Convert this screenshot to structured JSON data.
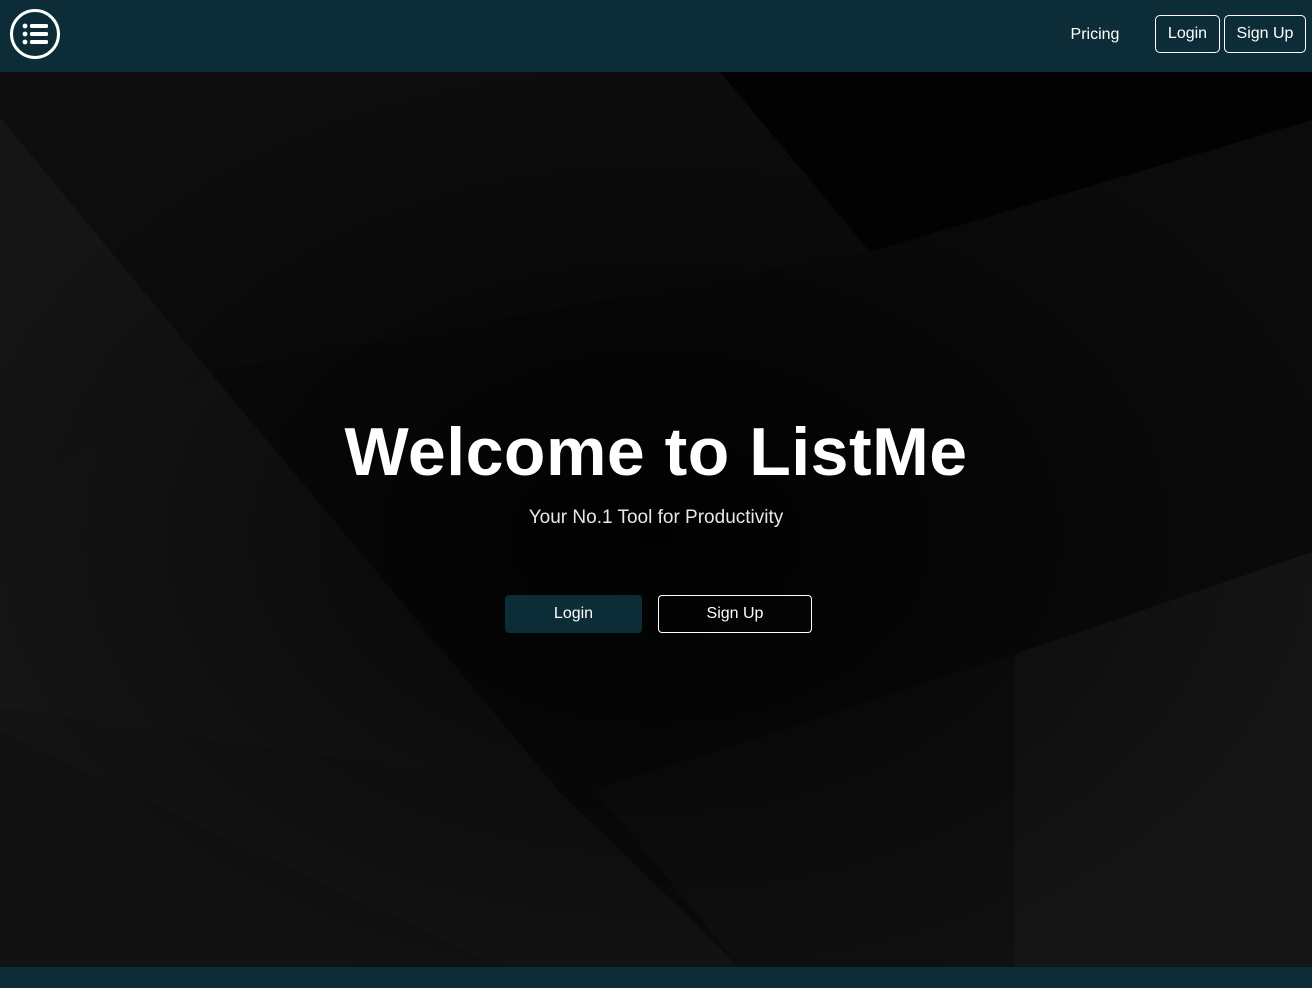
{
  "app": {
    "logo_icon": "list-icon"
  },
  "navbar": {
    "links": {
      "pricing": "Pricing"
    },
    "buttons": {
      "login": "Login",
      "signup": "Sign Up"
    }
  },
  "hero": {
    "title": "Welcome to ListMe",
    "subtitle": "Your No.1 Tool for Productivity",
    "buttons": {
      "login": "Login",
      "signup": "Sign Up"
    }
  },
  "colors": {
    "primary": "#0c2d38",
    "background": "#0a0a0a",
    "text": "#ffffff"
  }
}
